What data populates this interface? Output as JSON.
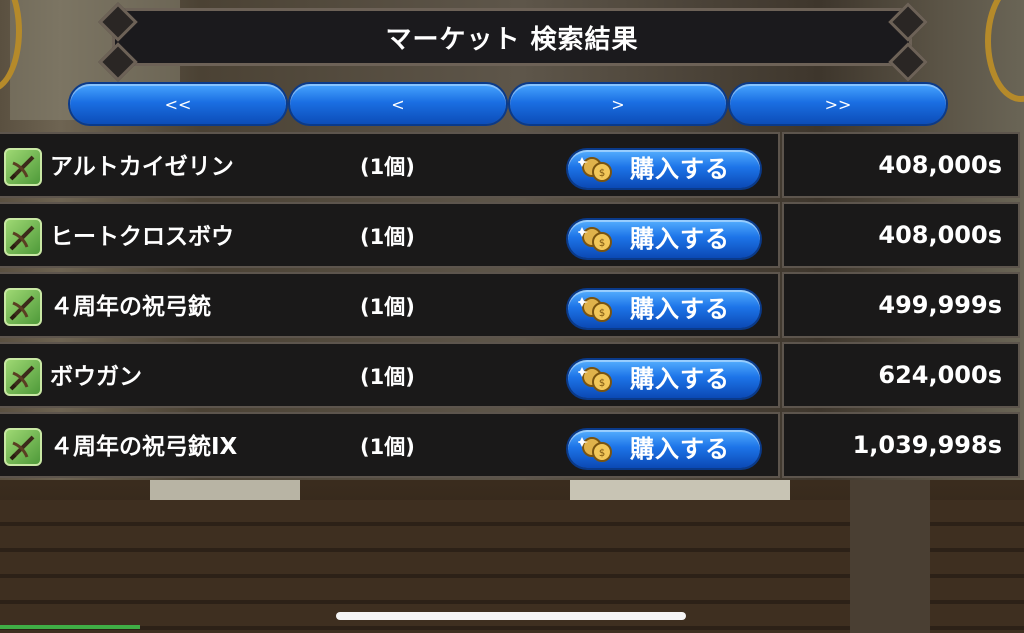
{
  "header": {
    "title": "マーケット 検索結果"
  },
  "pagination": {
    "first_label": "<<",
    "prev_label": "<",
    "next_label": ">",
    "last_label": ">>"
  },
  "buy_label": "購入する",
  "items": [
    {
      "name": "アルトカイゼリン",
      "quantity": "(1個)",
      "price": "408,000s"
    },
    {
      "name": "ヒートクロスボウ",
      "quantity": "(1個)",
      "price": "408,000s"
    },
    {
      "name": "４周年の祝弓銃",
      "quantity": "(1個)",
      "price": "499,999s"
    },
    {
      "name": "ボウガン",
      "quantity": "(1個)",
      "price": "624,000s"
    },
    {
      "name": "４周年の祝弓銃IX",
      "quantity": "(1個)",
      "price": "1,039,998s"
    }
  ],
  "colors": {
    "button_blue": "#1d74e8",
    "panel_bg": "#1a1919",
    "border": "#5d554d",
    "item_icon_green": "#4f9a3a"
  },
  "icons": {
    "item": "crossbow-icon",
    "buy": "coin-icon"
  }
}
